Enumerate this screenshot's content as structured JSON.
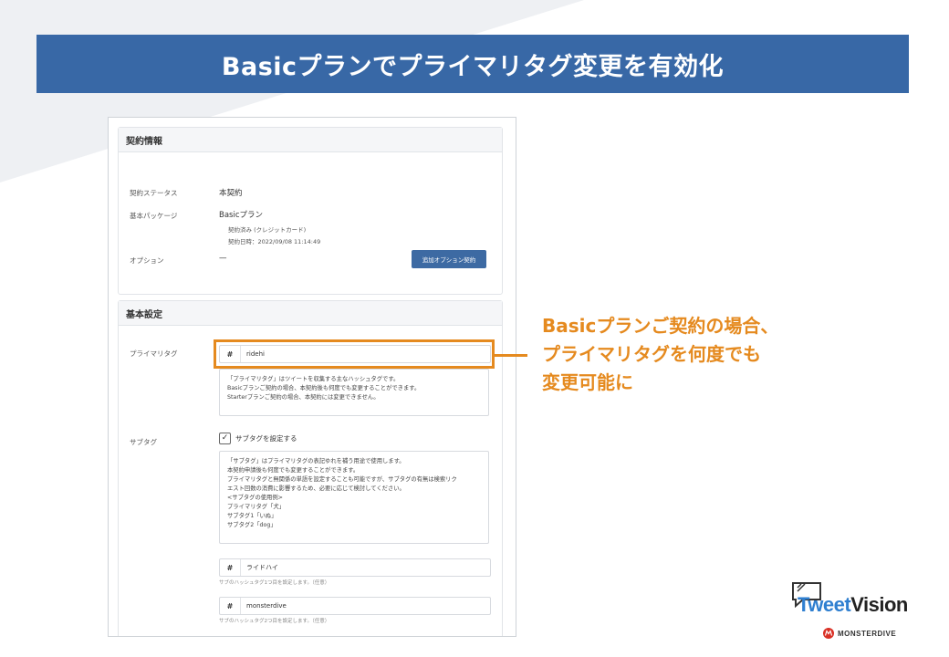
{
  "banner": {
    "title": "Basicプランでプライマリタグ変更を有効化"
  },
  "contract": {
    "header": "契約情報",
    "status_label": "契約ステータス",
    "status_value": "本契約",
    "package_label": "基本パッケージ",
    "package_value": "Basicプラン",
    "package_sub1": "契約済み (クレジットカード)",
    "package_sub2": "契約日時：2022/09/08 11:14:49",
    "option_label": "オプション",
    "option_value": "—",
    "option_button": "追加オプション契約"
  },
  "settings": {
    "header": "基本設定",
    "primary_label": "プライマリタグ",
    "primary_hash": "#",
    "primary_value": "ridehi",
    "primary_desc": [
      "「プライマリタグ」はツイートを収集する主なハッシュタグです。",
      "Basicプランご契約の場合、本契約後も何度でも変更することができます。",
      "Starterプランご契約の場合、本契約には変更できません。"
    ],
    "subtag_label": "サブタグ",
    "subtag_checkbox_label": "サブタグを設定する",
    "subtag_checked": "✓",
    "subtag_desc": [
      "「サブタグ」はプライマリタグの表記ゆれを補う用途で使用します。",
      "本契約申請後も何度でも変更することができます。",
      "プライマリタグと無関係の単語を設定することも可能ですが、サブタグの有無は検索リク",
      "エスト回数の消費に影響するため、必要に応じて検討してください。",
      "<サブタグの使用例>",
      "プライマリタグ「犬」",
      "サブタグ1「いぬ」",
      "サブタグ2「dog」"
    ],
    "subtag1_hash": "#",
    "subtag1_value": "ライドハイ",
    "subtag1_help": "サブのハッシュタグ1つ目を設定します。（任意）",
    "subtag2_hash": "#",
    "subtag2_value": "monsterdive",
    "subtag2_help": "サブのハッシュタグ2つ目を設定します。（任意）"
  },
  "callout": {
    "line1": "Basicプランご契約の場合、",
    "line2": "プライマリタグを何度でも",
    "line3": "変更可能に"
  },
  "logo": {
    "tweet": "Tweet",
    "vision": "Vision",
    "company": "MONSTERDIVE"
  },
  "colors": {
    "banner": "#3868a6",
    "accent": "#e58a1f",
    "button": "#3d6aa3"
  }
}
